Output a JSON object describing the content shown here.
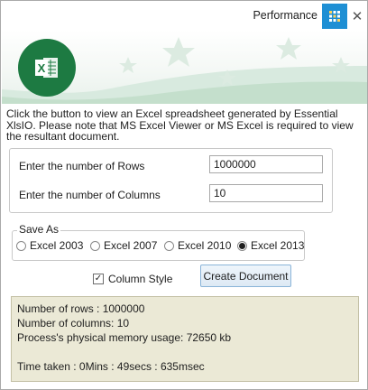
{
  "window": {
    "title": "Performance",
    "grid_icon": "grid-icon",
    "close_icon": "close-icon",
    "close_glyph": "✕",
    "accent_color": "#1e8fd4"
  },
  "banner": {
    "logo_icon": "excel-logo-icon",
    "logo_letter": "X",
    "logo_color": "#1d7a42"
  },
  "description": "Click the button to view an Excel spreadsheet generated by Essential XlsIO. Please note that MS Excel Viewer or MS Excel is required to view the resultant document.",
  "inputs": {
    "rows_label": "Enter the number of Rows",
    "rows_value": "1000000",
    "columns_label": "Enter the number of Columns",
    "columns_value": "10"
  },
  "save_as": {
    "legend": "Save As",
    "options": [
      {
        "label": "Excel 2003",
        "selected": false
      },
      {
        "label": "Excel 2007",
        "selected": false
      },
      {
        "label": "Excel 2010",
        "selected": false
      },
      {
        "label": "Excel 2013",
        "selected": true
      }
    ]
  },
  "column_style": {
    "label": "Column Style",
    "checked": true,
    "check_glyph": "✓"
  },
  "create_button_label": "Create Document",
  "output": {
    "rows_line": "Number of rows : 1000000",
    "columns_line": "Number of columns: 10",
    "memory_line": "Process's physical memory usage: 72650 kb",
    "time_line": "Time taken : 0Mins : 49secs : 635msec"
  }
}
